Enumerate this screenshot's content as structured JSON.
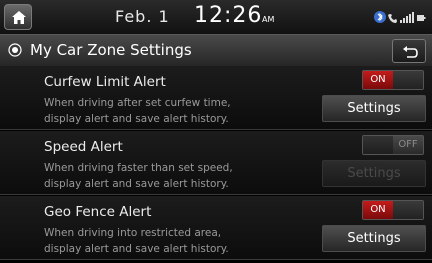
{
  "status": {
    "date": "Feb.  1",
    "time": "12:26",
    "ampm": "AM"
  },
  "header": {
    "title": "My Car Zone Settings"
  },
  "items": [
    {
      "title": "Curfew Limit Alert",
      "desc1": "When driving after set curfew time,",
      "desc2": "display alert and save alert history.",
      "toggle": "ON",
      "state": "on",
      "settings_label": "Settings"
    },
    {
      "title": "Speed Alert",
      "desc1": "When driving faster than set speed,",
      "desc2": "display alert and save alert history.",
      "toggle": "OFF",
      "state": "off",
      "settings_label": "Settings"
    },
    {
      "title": "Geo Fence Alert",
      "desc1": "When driving into restricted area,",
      "desc2": "display alert and save alert history.",
      "toggle": "ON",
      "state": "on",
      "settings_label": "Settings"
    }
  ],
  "colors": {
    "accent_on": "#c51c1c",
    "background": "#000000"
  },
  "icons": [
    "home-icon",
    "bluetooth-icon",
    "signal-icon",
    "settings-radio-icon",
    "back-icon"
  ]
}
